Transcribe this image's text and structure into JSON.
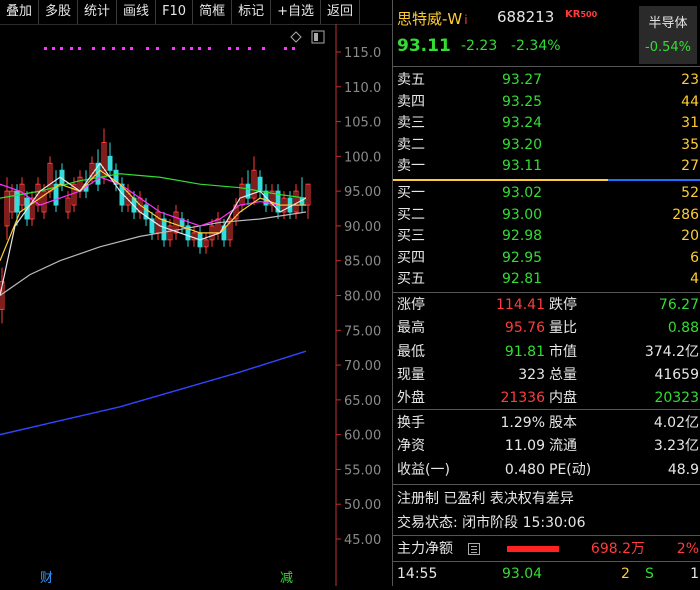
{
  "toolbar": {
    "buttons": [
      "叠加",
      "多股",
      "统计",
      "画线",
      "F10",
      "简框",
      "标记",
      "+自选",
      "返回"
    ]
  },
  "chart": {
    "y_ticks": [
      "115.0",
      "110.0",
      "105.0",
      "100.0",
      "95.00",
      "90.00",
      "85.00",
      "80.00",
      "75.00",
      "70.00",
      "65.00",
      "60.00",
      "55.00",
      "50.00",
      "45.00"
    ],
    "y_min": 45.0,
    "y_max": 115.0,
    "bottom_markers": [
      "财",
      "减"
    ],
    "colors": {
      "up": "#ff3b3b",
      "down": "#33dddd",
      "ma5": "#e6e6e6",
      "ma10": "#ffcc33",
      "ma20": "#ff33ff",
      "ma60": "#33dd33",
      "ma120": "#bbbbbb",
      "ma250": "#3344ff",
      "dots": "#ff33ff"
    }
  },
  "stock": {
    "name": "思特威-W",
    "name_suffix": "i",
    "code": "688213",
    "kr_label": "KR",
    "kr_sub": "500",
    "price": "93.11",
    "change": "-2.23",
    "change_pct": "-2.34%",
    "sector_name": "半导体",
    "sector_pct": "-0.54%"
  },
  "order_book": {
    "asks": [
      {
        "label": "卖五",
        "price": "93.27",
        "vol": "23"
      },
      {
        "label": "卖四",
        "price": "93.25",
        "vol": "44"
      },
      {
        "label": "卖三",
        "price": "93.24",
        "vol": "31"
      },
      {
        "label": "卖二",
        "price": "93.20",
        "vol": "35"
      },
      {
        "label": "卖一",
        "price": "93.11",
        "vol": "27"
      }
    ],
    "bids": [
      {
        "label": "买一",
        "price": "93.02",
        "vol": "52"
      },
      {
        "label": "买二",
        "price": "93.00",
        "vol": "286"
      },
      {
        "label": "买三",
        "price": "92.98",
        "vol": "20"
      },
      {
        "label": "买四",
        "price": "92.95",
        "vol": "6"
      },
      {
        "label": "买五",
        "price": "92.81",
        "vol": "4"
      }
    ]
  },
  "stats1": [
    {
      "l1": "涨停",
      "v1": "114.41",
      "c1": "#ff3b3b",
      "l2": "跌停",
      "v2": "76.27",
      "c2": "#33dd33"
    },
    {
      "l1": "最高",
      "v1": "95.76",
      "c1": "#ff3b3b",
      "l2": "量比",
      "v2": "0.88",
      "c2": "#33dd33"
    },
    {
      "l1": "最低",
      "v1": "91.81",
      "c1": "#33dd33",
      "l2": "市值",
      "v2": "374.2亿",
      "c2": "#e6e6e6"
    },
    {
      "l1": "现量",
      "v1": "323",
      "c1": "#e6e6e6",
      "l2": "总量",
      "v2": "41659",
      "c2": "#e6e6e6"
    },
    {
      "l1": "外盘",
      "v1": "21336",
      "c1": "#ff3b3b",
      "l2": "内盘",
      "v2": "20323",
      "c2": "#33dd33"
    }
  ],
  "stats2": [
    {
      "l1": "换手",
      "v1": "1.29%",
      "c1": "#e6e6e6",
      "l2": "股本",
      "v2": "4.02亿",
      "c2": "#e6e6e6"
    },
    {
      "l1": "净资",
      "v1": "11.09",
      "c1": "#e6e6e6",
      "l2": "流通",
      "v2": "3.23亿",
      "c2": "#e6e6e6"
    },
    {
      "l1": "收益(一)",
      "v1": "0.480",
      "c1": "#e6e6e6",
      "l2": "PE(动)",
      "v2": "48.9",
      "c2": "#e6e6e6"
    }
  ],
  "info": {
    "registration": "注册制 已盈利 表决权有差异",
    "trade_status": "交易状态: 闭市阶段 15:30:06"
  },
  "main_flow": {
    "label": "主力净额",
    "amount": "698.2万",
    "pct": "2%",
    "bar_color": "#ff2222"
  },
  "last_tick": {
    "time": "14:55",
    "price": "93.04",
    "vol": "2",
    "side": "S",
    "count": "1"
  }
}
